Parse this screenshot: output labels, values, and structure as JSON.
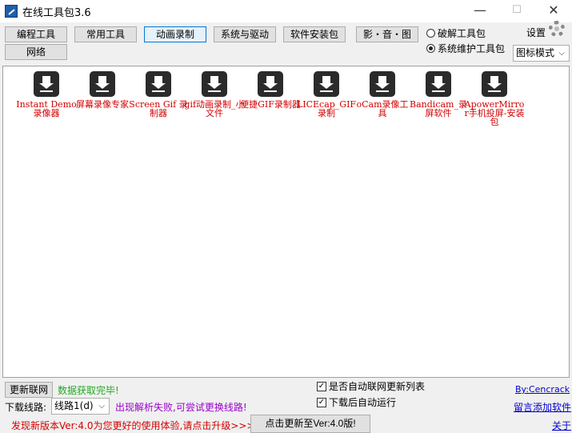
{
  "window": {
    "title": "在线工具包3.6",
    "minimize": "—",
    "maximize": "☐",
    "close": "✕"
  },
  "tabs": [
    {
      "label": "编程工具"
    },
    {
      "label": "常用工具"
    },
    {
      "label": "动画录制",
      "active": true
    },
    {
      "label": "系统与驱动"
    },
    {
      "label": "软件安装包"
    },
    {
      "label": "影・音・图"
    },
    {
      "label": "网络"
    }
  ],
  "radios": [
    {
      "label": "破解工具包",
      "checked": false
    },
    {
      "label": "系统维护工具包",
      "checked": true
    }
  ],
  "settings_label": "设置",
  "view_mode": "图标模式",
  "tools": [
    {
      "label": "Instant Demo 录像器"
    },
    {
      "label": "屏幕录像专家"
    },
    {
      "label": "Screen Gif 录制器"
    },
    {
      "label": "gif动画录制_小文件"
    },
    {
      "label": "便捷GIF录制器"
    },
    {
      "label": "LICEcap_GIF 录制"
    },
    {
      "label": "oCam录像工具"
    },
    {
      "label": "Bandicam_录屏软件"
    },
    {
      "label": "ApowerMirror手机投屏-安装包"
    }
  ],
  "bottom": {
    "refresh_button": "更新联网",
    "status_text": "数据获取完毕!",
    "auto_update_label": "是否自动联网更新列表",
    "auto_update_checked": true,
    "auto_run_label": "下载后自动运行",
    "auto_run_checked": true,
    "author_link": "By:Cencrack",
    "download_route_label": "下载线路:",
    "route_value": "线路1(d)",
    "route_hint": "出现解析失败,可尝试更换线路!",
    "leave_message_link": "留言添加软件",
    "update_notice": "发现新版本Ver:4.0为您更好的使用体验,请点击升级>>>",
    "update_button": "点击更新至Ver:4.0版!",
    "about_link": "关于"
  },
  "colors": {
    "accent": "#0078d7",
    "tool_label": "#d40000",
    "status_green": "#22aa22",
    "hint_purple": "#9900cc",
    "notice_red": "#d40000",
    "link_blue": "#0000cc"
  }
}
